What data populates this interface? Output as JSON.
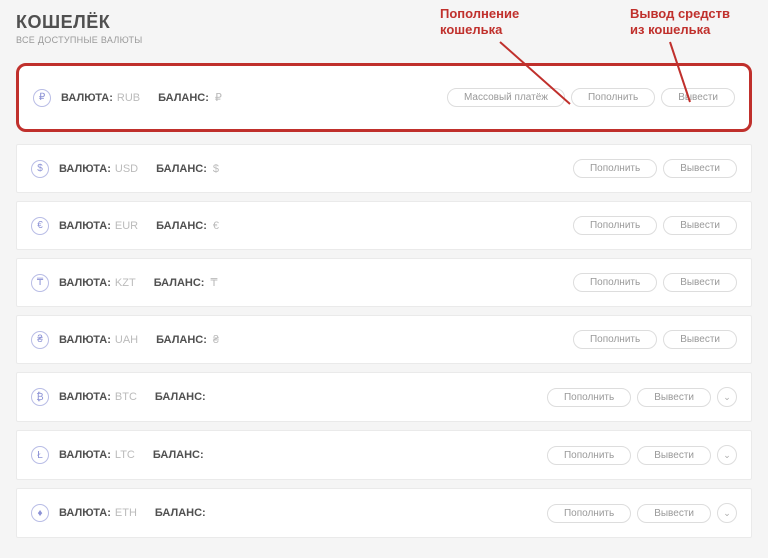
{
  "header": {
    "title": "КОШЕЛЁК",
    "subtitle": "ВСЕ ДОСТУПНЫЕ ВАЛЮТЫ"
  },
  "labels": {
    "currency": "ВАЛЮТА:",
    "balance": "БАЛАНС:",
    "mass_pay": "Массовый платёж",
    "deposit": "Пополнить",
    "withdraw": "Вывести"
  },
  "rows": [
    {
      "code": "RUB",
      "sym": "₽",
      "symbol": "₽",
      "highlight": true,
      "mass": true,
      "expand": false
    },
    {
      "code": "USD",
      "sym": "$",
      "symbol": "$",
      "highlight": false,
      "mass": false,
      "expand": false
    },
    {
      "code": "EUR",
      "sym": "€",
      "symbol": "€",
      "highlight": false,
      "mass": false,
      "expand": false
    },
    {
      "code": "KZT",
      "sym": "₸",
      "symbol": "₸",
      "highlight": false,
      "mass": false,
      "expand": false
    },
    {
      "code": "UAH",
      "sym": "₴",
      "symbol": "₴",
      "highlight": false,
      "mass": false,
      "expand": false
    },
    {
      "code": "BTC",
      "sym": "₿",
      "symbol": "",
      "highlight": false,
      "mass": false,
      "expand": true
    },
    {
      "code": "LTC",
      "sym": "Ł",
      "symbol": "",
      "highlight": false,
      "mass": false,
      "expand": true
    },
    {
      "code": "ETH",
      "sym": "♦",
      "symbol": "",
      "highlight": false,
      "mass": false,
      "expand": true
    }
  ],
  "annotations": {
    "deposit": "Пополнение\nкошелька",
    "withdraw": "Вывод средств\nиз кошелька"
  }
}
